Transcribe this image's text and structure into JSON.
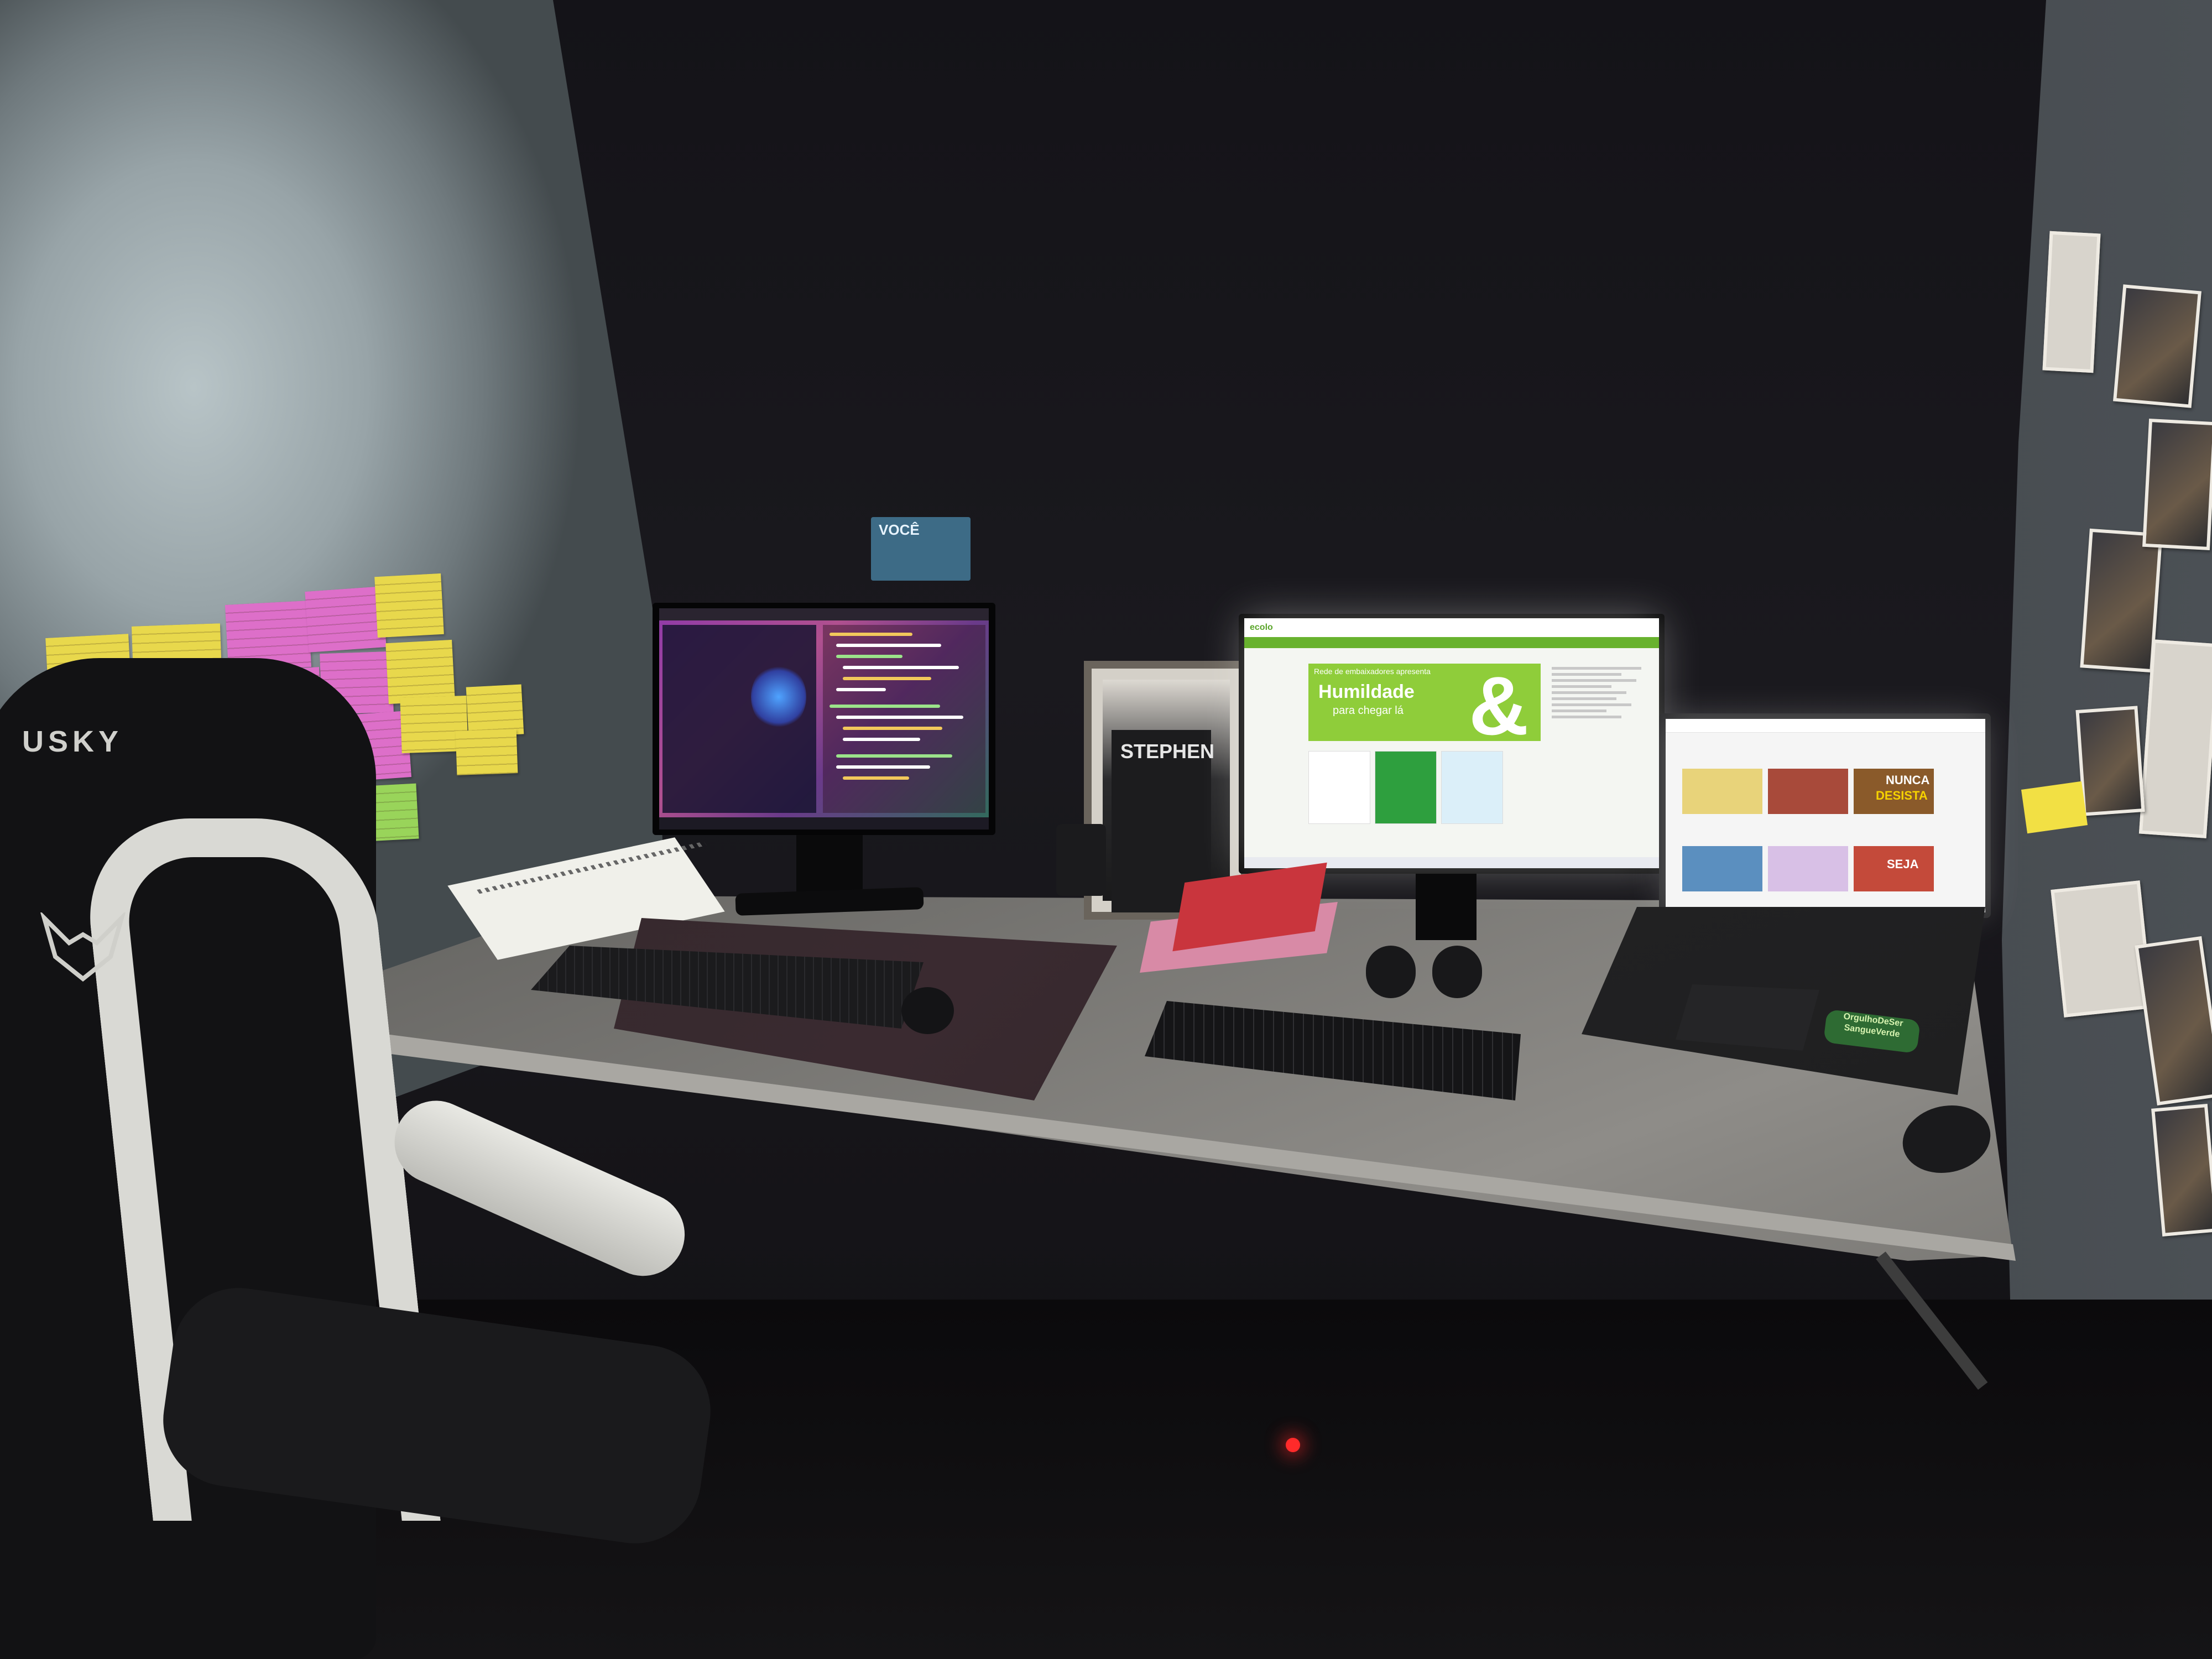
{
  "wall_notes": {
    "voce_card_label": "VOCÊ"
  },
  "chair": {
    "brand_label": "USKY",
    "logo_icon": "fox-logo-icon"
  },
  "book": {
    "spine_label": "STEPHEN"
  },
  "monitor_center": {
    "site_logo": "ecolo",
    "banner_small": "Rede de embaixadores apresenta",
    "banner_title": "Humildade",
    "banner_subtitle": "para chegar lá"
  },
  "laptop": {
    "thumb_nunca": "NUNCA",
    "thumb_desista": "DESISTA",
    "thumb_seja": "SEJA",
    "sticker_label": "OrgulhoDeSer SangueVerde"
  },
  "colors": {
    "sticky_yellow": "#e8d84c",
    "sticky_pink": "#dd6fc9",
    "sticky_green": "#99d45a",
    "brand_green": "#68b22e"
  }
}
